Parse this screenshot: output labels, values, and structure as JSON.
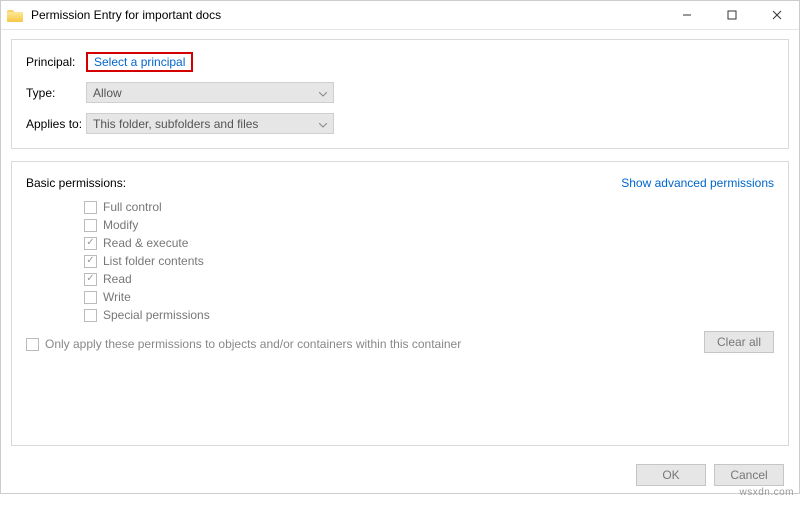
{
  "window": {
    "title": "Permission Entry for important docs"
  },
  "principal": {
    "label": "Principal:",
    "link": "Select a principal"
  },
  "type": {
    "label": "Type:",
    "value": "Allow"
  },
  "appliesTo": {
    "label": "Applies to:",
    "value": "This folder, subfolders and files"
  },
  "basicPermissions": {
    "heading": "Basic permissions:",
    "advancedLink": "Show advanced permissions",
    "items": [
      {
        "label": "Full control",
        "checked": false
      },
      {
        "label": "Modify",
        "checked": false
      },
      {
        "label": "Read & execute",
        "checked": true
      },
      {
        "label": "List folder contents",
        "checked": true
      },
      {
        "label": "Read",
        "checked": true
      },
      {
        "label": "Write",
        "checked": false
      },
      {
        "label": "Special permissions",
        "checked": false
      }
    ]
  },
  "onlyApply": {
    "label": "Only apply these permissions to objects and/or containers within this container",
    "checked": false
  },
  "buttons": {
    "clearAll": "Clear all",
    "ok": "OK",
    "cancel": "Cancel"
  },
  "watermark": "wsxdn.com"
}
